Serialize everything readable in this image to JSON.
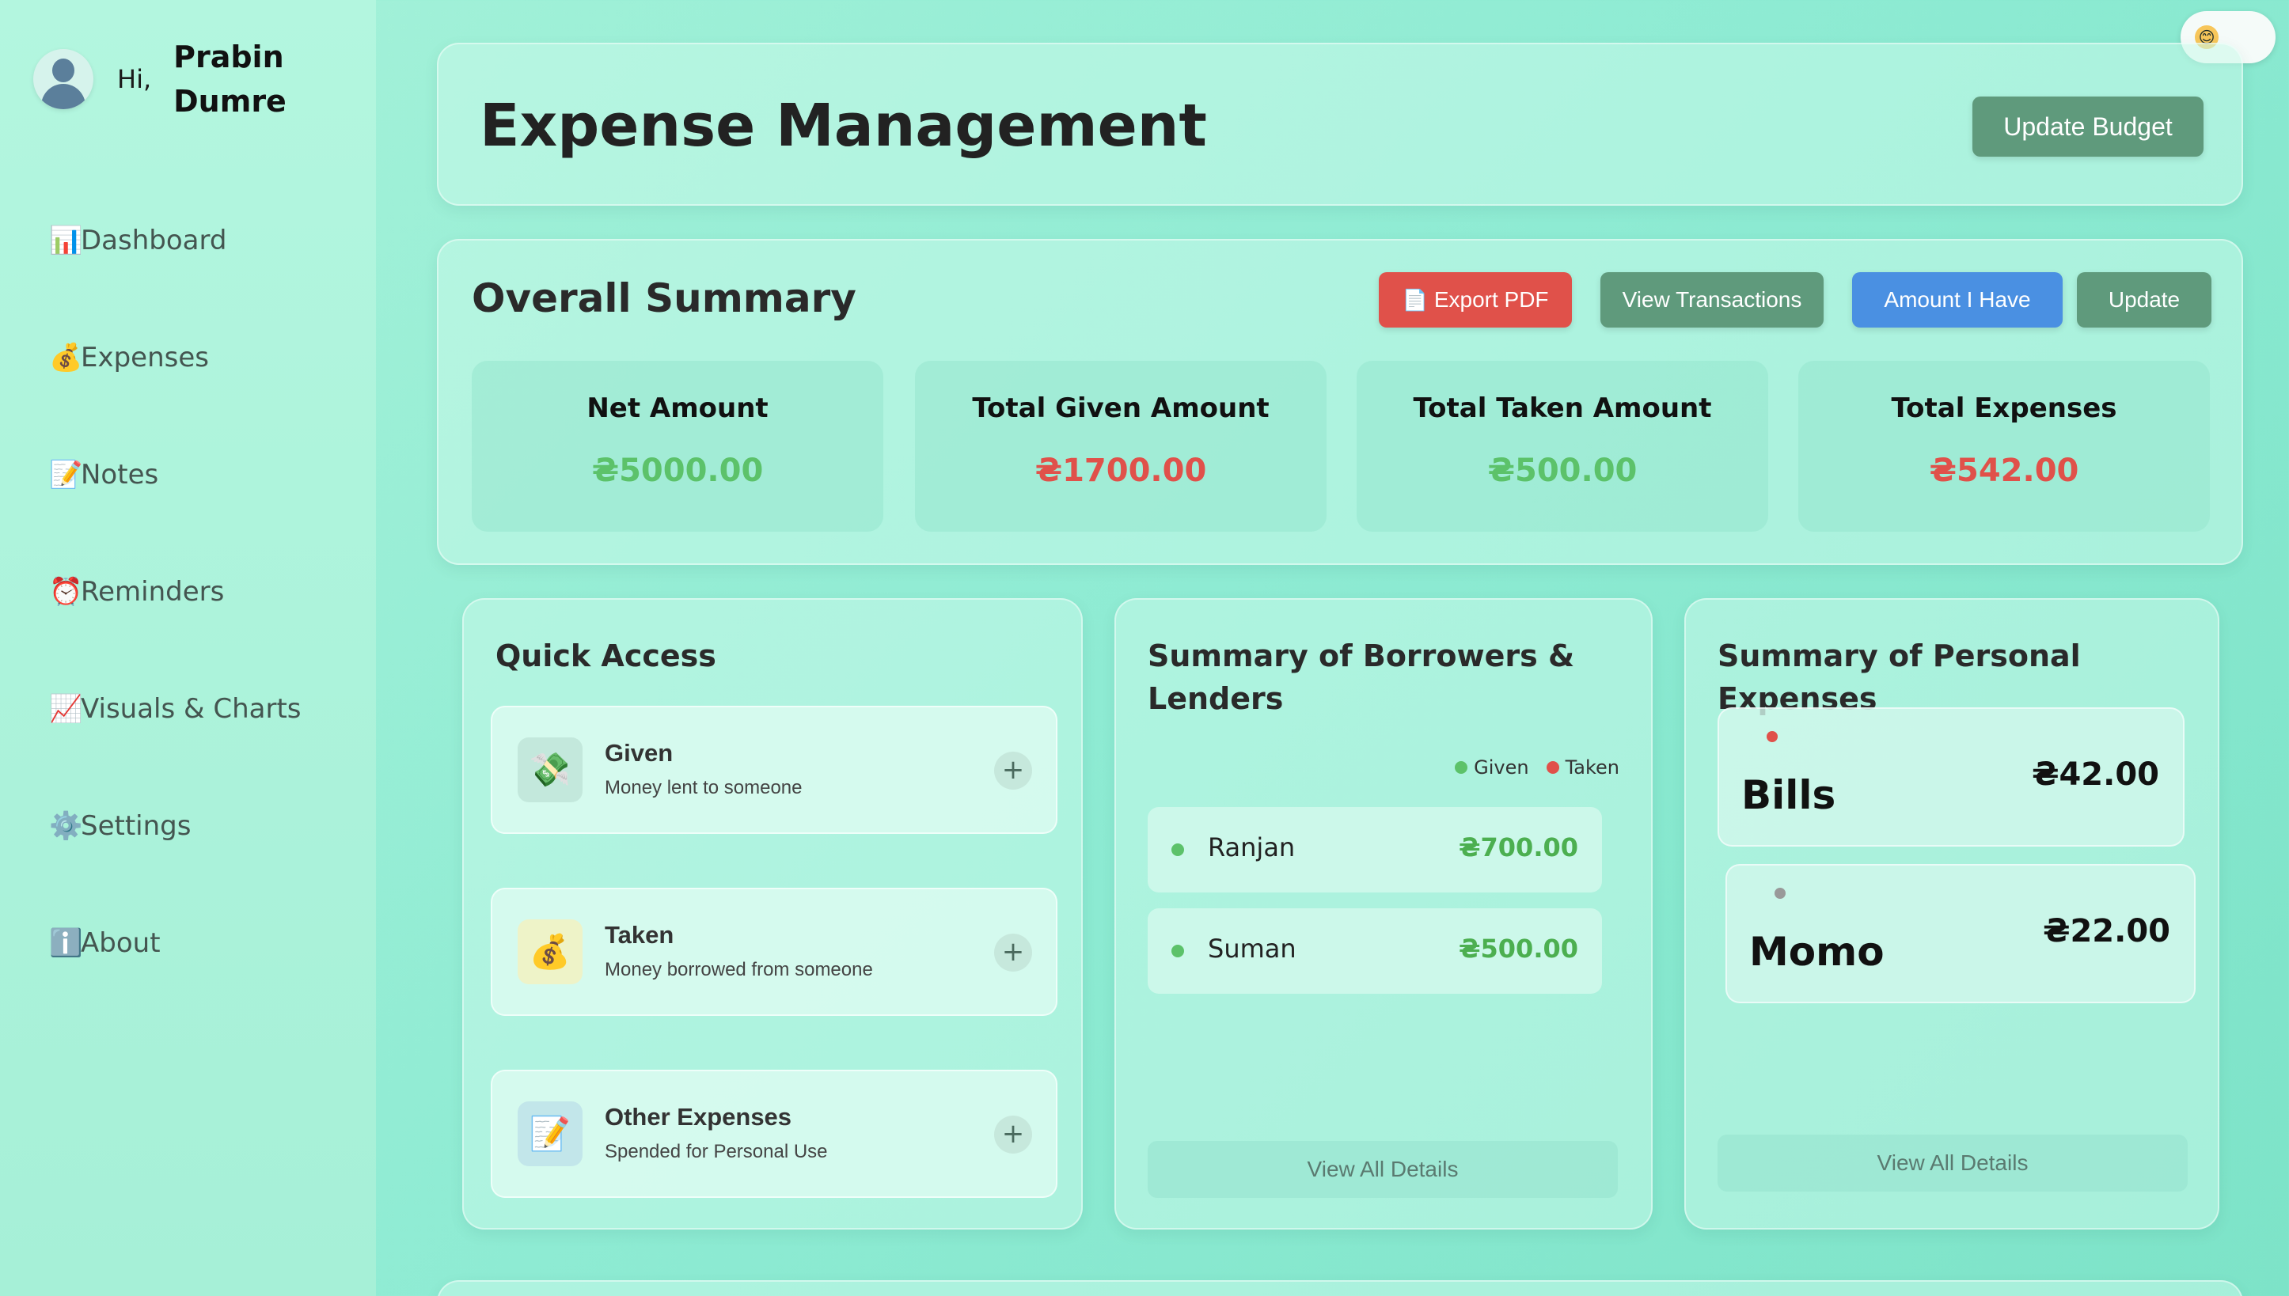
{
  "user": {
    "greeting": "Hi,",
    "first_name": "Prabin",
    "last_name": "Dumre"
  },
  "sidebar": {
    "items": [
      {
        "icon": "📊",
        "label": "Dashboard"
      },
      {
        "icon": "💰",
        "label": "Expenses"
      },
      {
        "icon": "📝",
        "label": "Notes"
      },
      {
        "icon": "⏰",
        "label": "Reminders"
      },
      {
        "icon": "📈",
        "label": "Visuals & Charts"
      },
      {
        "icon": "⚙️",
        "label": "Settings"
      },
      {
        "icon": "ℹ️",
        "label": "About"
      }
    ]
  },
  "theme_toggle": {
    "icon": "😊"
  },
  "header": {
    "title": "Expense Management",
    "update_budget": "Update Budget"
  },
  "summary": {
    "title": "Overall Summary",
    "buttons": {
      "export_pdf": "Export PDF",
      "export_icon": "📄",
      "view_transactions": "View Transactions",
      "amount_i_have": "Amount I Have",
      "update": "Update"
    },
    "stats": [
      {
        "label": "Net Amount",
        "value": "₴5000.00",
        "color": "#5cc26a"
      },
      {
        "label": "Total Given Amount",
        "value": "₴1700.00",
        "color": "#e0514a"
      },
      {
        "label": "Total Taken Amount",
        "value": "₴500.00",
        "color": "#5cc26a"
      },
      {
        "label": "Total Expenses",
        "value": "₴542.00",
        "color": "#e0514a"
      }
    ]
  },
  "quick_access": {
    "title": "Quick Access",
    "items": [
      {
        "icon": "💸",
        "title": "Given",
        "subtitle": "Money lent to someone",
        "plus": "+"
      },
      {
        "icon": "💰",
        "title": "Taken",
        "subtitle": "Money borrowed from someone",
        "plus": "+"
      },
      {
        "icon": "📝",
        "title": "Other Expenses",
        "subtitle": "Spended for Personal Use",
        "plus": "+"
      }
    ]
  },
  "borrowers": {
    "title": "Summary of Borrowers & Lenders",
    "legend": {
      "given": "Given",
      "taken": "Taken",
      "given_color": "#5cc26a",
      "taken_color": "#e0514a"
    },
    "rows": [
      {
        "name": "Ranjan",
        "amount": "₴700.00"
      },
      {
        "name": "Suman",
        "amount": "₴500.00"
      }
    ],
    "view_all": "View All Details"
  },
  "personal": {
    "title": "Summary of Personal Expenses",
    "items": [
      {
        "name": "Bills",
        "amount": "₴42.00",
        "dot_color": "#e0514a"
      },
      {
        "name": "Momo",
        "amount": "₴22.00",
        "dot_color": "#999999"
      }
    ],
    "view_all": "View All Details"
  }
}
